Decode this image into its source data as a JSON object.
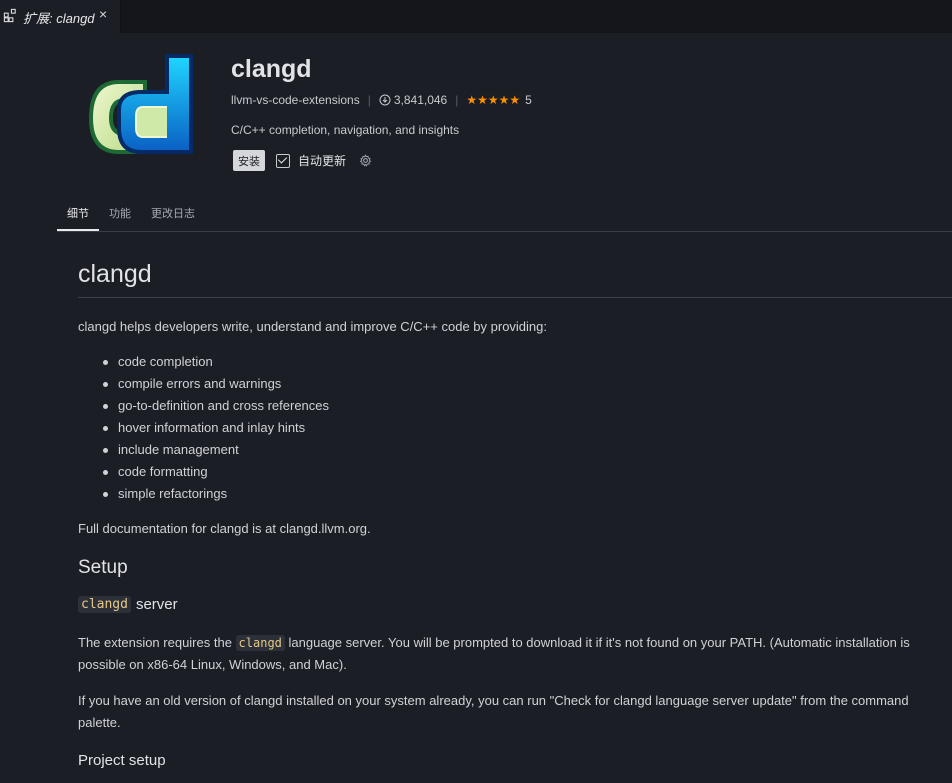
{
  "tab": {
    "title": "扩展: clangd",
    "close_glyph": "×",
    "icon": "extensions-icon"
  },
  "extension": {
    "name": "clangd",
    "publisher": "llvm-vs-code-extensions",
    "downloads": "3,841,046",
    "stars": "★★★★★",
    "rating": "5",
    "description": "C/C++ completion, navigation, and insights",
    "install_label": "安装",
    "auto_update_label": "自动更新",
    "auto_update_checked": true
  },
  "nav": {
    "tabs": [
      {
        "label": "细节",
        "active": true
      },
      {
        "label": "功能",
        "active": false
      },
      {
        "label": "更改日志",
        "active": false
      }
    ]
  },
  "readme": {
    "title": "clangd",
    "intro": "clangd helps developers write, understand and improve C/C++ code by providing:",
    "features": [
      "code completion",
      "compile errors and warnings",
      "go-to-definition and cross references",
      "hover information and inlay hints",
      "include management",
      "code formatting",
      "simple refactorings"
    ],
    "docs": "Full documentation for clangd is at clangd.llvm.org.",
    "setup_heading": "Setup",
    "server_code": "clangd",
    "server_heading": "server",
    "setup_p1_pre": "The extension requires the ",
    "setup_p1_code": "clangd",
    "setup_p1_line1": " language server. You will be prompted to download it if it's not found on your PATH. (Automatic installation is",
    "setup_p1_line2": "possible on x86-64 Linux, Windows, and Mac).",
    "setup_p2_line1": "If you have an old version of clangd installed on your system already, you can run \"Check for clangd language server update\" from the command",
    "setup_p2_line2": "palette.",
    "project_setup_heading": "Project setup"
  },
  "colors": {
    "background": "#1b1e25",
    "star": "#ff8e00",
    "code_text": "#e6c98a"
  }
}
